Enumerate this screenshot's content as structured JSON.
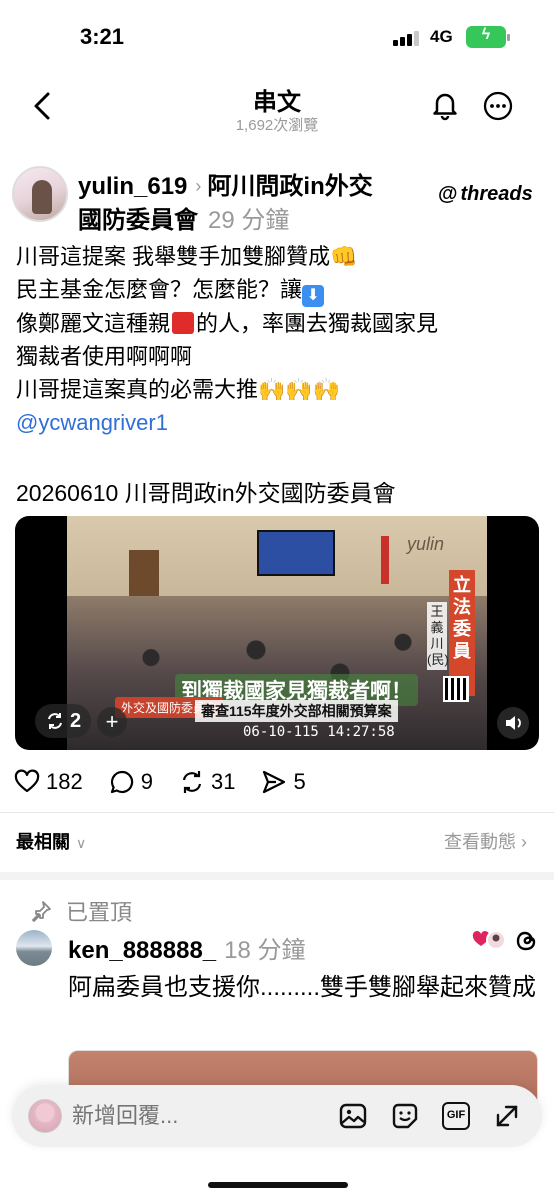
{
  "status_bar": {
    "time": "3:21",
    "network": "4G"
  },
  "header": {
    "title": "串文",
    "views": "1,692次瀏覽"
  },
  "post": {
    "username": "yulin_619",
    "topic_part1": "阿川問政in外交",
    "topic_part2": "國防委員會",
    "time": "29 分鐘",
    "brand": "threads",
    "lines": [
      "川哥這提案 我舉雙手加雙腳贊成👊",
      "民主基金怎麼會？怎麼能？讓",
      "像鄭麗文這種親",
      "的人，率團去獨裁國家見",
      "獨裁者使用啊啊啊",
      "川哥提這案真的必需大推🙌🙌🙌"
    ],
    "mention": "@ycwangriver1",
    "video_caption": "20260610 川哥問政in外交國防委員會",
    "video": {
      "banner": "立法委員",
      "banner_name": "王義川(民)",
      "subtitle": "到獨裁國家見獨裁者啊！",
      "committee_tag": "外交及國防委員會",
      "review_text": "審查115年度外交部相關預算案",
      "timestamp": "06-10-115  14:27:58",
      "room_logo": "yulin",
      "repost_count": "2"
    },
    "counts": {
      "likes": "182",
      "comments": "9",
      "reposts": "31",
      "shares": "5"
    }
  },
  "sort": {
    "label": "最相關",
    "activity": "查看動態"
  },
  "reply": {
    "pinned_label": "已置頂",
    "username": "ken_888888_",
    "time": "18 分鐘",
    "text": "阿扁委員也支援你.........雙手雙腳舉起來贊成"
  },
  "composer": {
    "placeholder": "新增回覆..."
  },
  "colors": {
    "mention": "#2f6fd6",
    "battery": "#35c759",
    "muted": "#999999"
  }
}
